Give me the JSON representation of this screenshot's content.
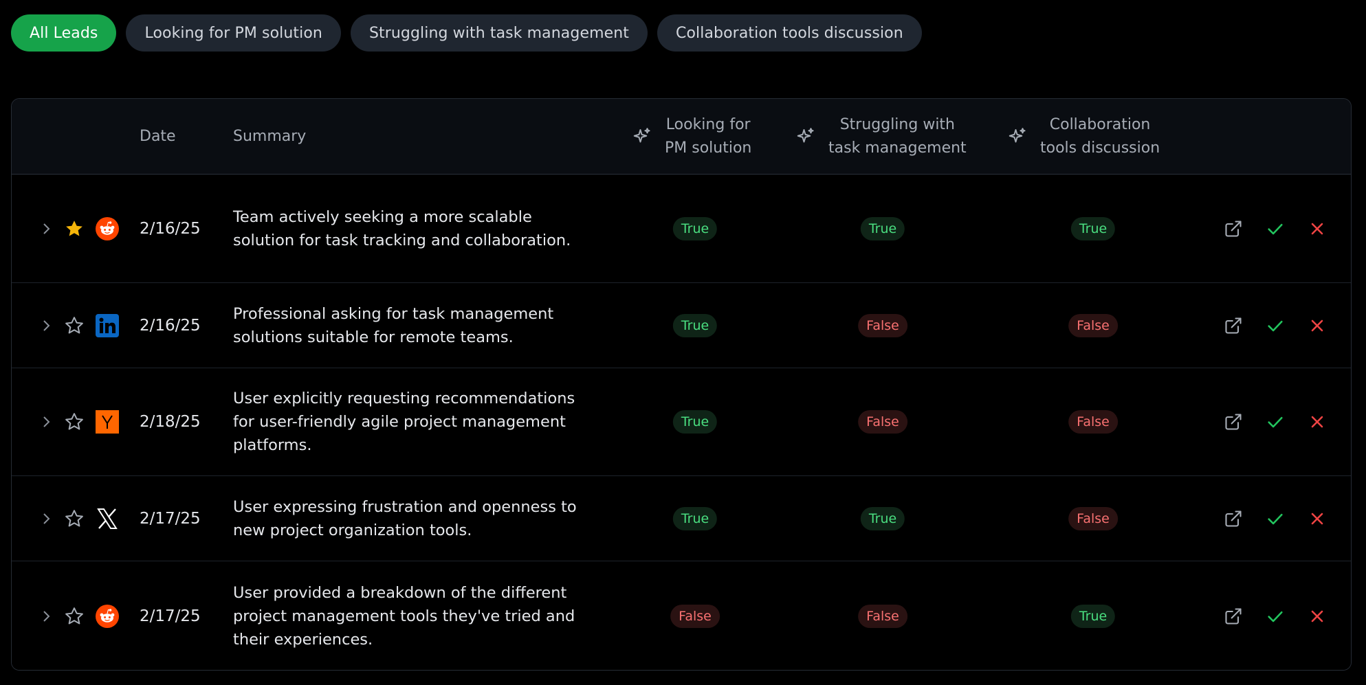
{
  "filters": [
    {
      "label": "All Leads",
      "active": true
    },
    {
      "label": "Looking for PM solution",
      "active": false
    },
    {
      "label": "Struggling with task management",
      "active": false
    },
    {
      "label": "Collaboration tools discussion",
      "active": false
    }
  ],
  "headers": {
    "date": "Date",
    "summary": "Summary",
    "col1": [
      "Looking for",
      "PM solution"
    ],
    "col2": [
      "Struggling with",
      "task management"
    ],
    "col3": [
      "Collaboration",
      "tools discussion"
    ]
  },
  "rows": [
    {
      "starred": true,
      "source": "reddit-icon",
      "date": "2/16/25",
      "summary": "Team actively seeking a more scalable solution for task tracking and collaboration.",
      "v": [
        "True",
        "True",
        "True"
      ]
    },
    {
      "starred": false,
      "source": "linkedin-icon",
      "date": "2/16/25",
      "summary": "Professional asking for task management solutions suitable for remote teams.",
      "v": [
        "True",
        "False",
        "False"
      ]
    },
    {
      "starred": false,
      "source": "ycombinator-icon",
      "date": "2/18/25",
      "summary": "User explicitly requesting recommendations for user-friendly agile project management platforms.",
      "v": [
        "True",
        "False",
        "False"
      ]
    },
    {
      "starred": false,
      "source": "x-icon",
      "date": "2/17/25",
      "summary": "User expressing frustration and openness to new project organization tools.",
      "v": [
        "True",
        "True",
        "False"
      ]
    },
    {
      "starred": false,
      "source": "reddit-icon",
      "date": "2/17/25",
      "summary": "User provided a breakdown of the different project management tools they've tried and their experiences.",
      "v": [
        "False",
        "False",
        "True"
      ]
    }
  ],
  "colors": {
    "accent": "#16a34a",
    "true_text": "#4ade80",
    "false_text": "#f87171",
    "star": "#f5b50a",
    "reddit": "#ff4500",
    "linkedin": "#0a66c2",
    "yc": "#ff6600"
  }
}
